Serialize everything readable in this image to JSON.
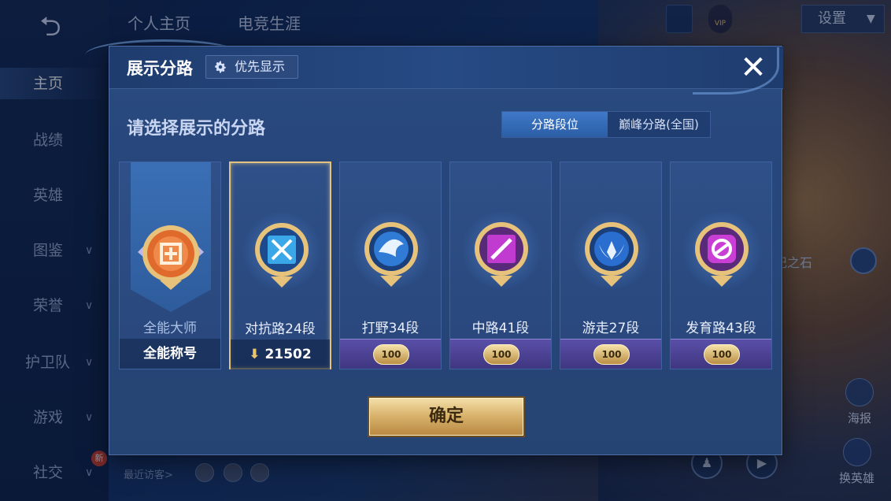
{
  "background": {
    "top_tabs": [
      "个人主页",
      "电竞生涯"
    ],
    "nav_items": [
      {
        "label": "主页",
        "has_chevron": false
      },
      {
        "label": "战绩",
        "has_chevron": false
      },
      {
        "label": "英雄",
        "has_chevron": false
      },
      {
        "label": "图鉴",
        "has_chevron": true
      },
      {
        "label": "荣誉",
        "has_chevron": true
      },
      {
        "label": "护卫队",
        "has_chevron": true
      },
      {
        "label": "游戏",
        "has_chevron": true
      },
      {
        "label": "社交",
        "has_chevron": true
      }
    ],
    "new_badge": "新",
    "settings_label": "设置",
    "vip_text": "VIP",
    "recent_visitors_label": "最近访客>",
    "stone_label": "记之石",
    "poster_label": "海报",
    "change_hero_label": "换英雄"
  },
  "dialog": {
    "title": "展示分路",
    "priority_label": "优先显示",
    "close_glyph": "✕",
    "subtitle": "请选择展示的分路",
    "tabs": [
      {
        "label": "分路段位",
        "active": true
      },
      {
        "label": "巅峰分路(全国)",
        "active": false
      }
    ],
    "cards": [
      {
        "name": "全能大师",
        "footer": "全能称号",
        "type": "master",
        "badge_color": "#e06a2c"
      },
      {
        "name": "对抗路24段",
        "footer": "21502",
        "type": "score",
        "selected": true,
        "badge_color": "#3aa8e8",
        "badge_icon": "sword-icon"
      },
      {
        "name": "打野34段",
        "footer": "100",
        "type": "ribbon",
        "badge_color": "#2f7bd6",
        "badge_icon": "dragon-icon"
      },
      {
        "name": "中路41段",
        "footer": "100",
        "type": "ribbon",
        "badge_color": "#c23bd1",
        "badge_icon": "slash-icon"
      },
      {
        "name": "游走27段",
        "footer": "100",
        "type": "ribbon",
        "badge_color": "#2a6fd0",
        "badge_icon": "wings-icon"
      },
      {
        "name": "发育路43段",
        "footer": "100",
        "type": "ribbon",
        "badge_color": "#c93fd6",
        "badge_icon": "target-icon"
      }
    ],
    "confirm_label": "确定"
  }
}
